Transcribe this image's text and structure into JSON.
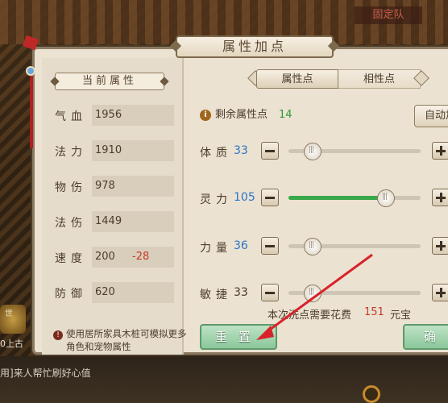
{
  "background": {
    "team_label": "固定队",
    "bottom_text": "用]来人帮忙刷好心值",
    "left_text": "0上古",
    "left_small": "世"
  },
  "panel": {
    "title": "属性加点"
  },
  "current_attributes": {
    "header": "当前属性",
    "stats": [
      {
        "label": "气血",
        "value": "1956"
      },
      {
        "label": "法力",
        "value": "1910"
      },
      {
        "label": "物伤",
        "value": "978"
      },
      {
        "label": "法伤",
        "value": "1449"
      },
      {
        "label": "速度",
        "value": "200",
        "delta": "-28"
      },
      {
        "label": "防御",
        "value": "620"
      }
    ],
    "hint": "使用居所家具木桩可模拟更多角色和宠物属性"
  },
  "tabs": [
    {
      "label": "属性点",
      "active": true
    },
    {
      "label": "相性点",
      "active": false
    }
  ],
  "remaining": {
    "label": "剩余属性点",
    "value": "14",
    "auto_button": "自动加"
  },
  "attributes": [
    {
      "label": "体质",
      "value": "33",
      "value_color": "blue",
      "fill": 0.18
    },
    {
      "label": "灵力",
      "value": "105",
      "value_color": "blue",
      "fill": 0.74
    },
    {
      "label": "力量",
      "value": "36",
      "value_color": "blue",
      "fill": 0.18
    },
    {
      "label": "敏捷",
      "value": "33",
      "value_color": "dark",
      "fill": 0.18
    }
  ],
  "cost": {
    "label": "本次洗点需要花费",
    "value": "151",
    "unit": "元宝"
  },
  "buttons": {
    "reset": "重置",
    "confirm": "确"
  },
  "colors": {
    "accent_green": "#38a84a",
    "value_blue": "#2b74c4",
    "delta_red": "#c23a28",
    "arrow_red": "#d8232a"
  }
}
